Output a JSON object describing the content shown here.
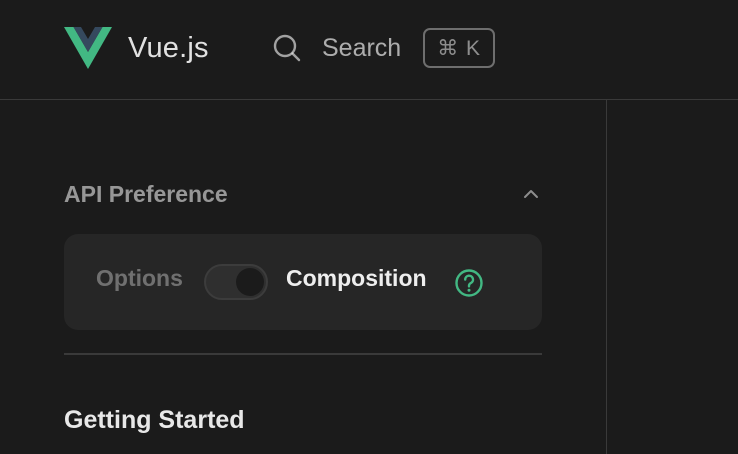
{
  "navbar": {
    "brand": {
      "title": "Vue.js",
      "logo_icon": "vue-logo-icon",
      "logo_colors": {
        "outer": "#42b883",
        "inner": "#35495e"
      }
    },
    "search": {
      "icon": "search-icon",
      "label": "Search",
      "shortcut": "⌘ K"
    }
  },
  "sidebar": {
    "api_preference": {
      "title": "API Preference",
      "collapse_icon": "chevron-up-icon",
      "options": [
        {
          "label": "Options",
          "selected": false
        },
        {
          "label": "Composition",
          "selected": true
        }
      ],
      "help_icon": "question-circle-icon",
      "accent_color": "#42b883"
    },
    "sections": [
      {
        "title": "Getting Started"
      }
    ]
  },
  "colors": {
    "background": "#1b1b1b",
    "card": "#262626",
    "divider": "#3a3a3a",
    "accent": "#42b883"
  }
}
